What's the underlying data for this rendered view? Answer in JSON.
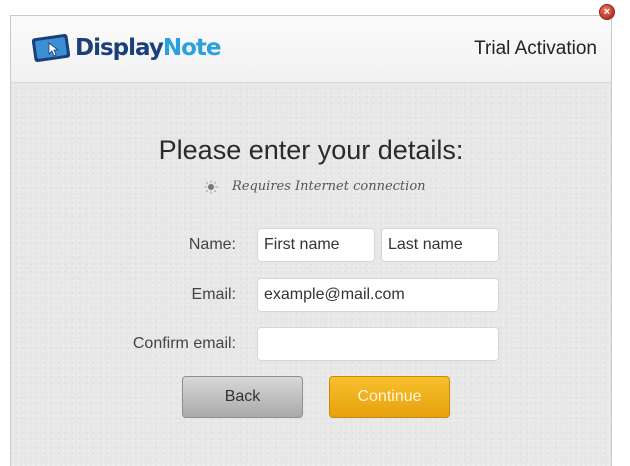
{
  "app": {
    "logo_part1": "Display",
    "logo_part2": "Note",
    "window_title": "Trial Activation",
    "close_glyph": "×"
  },
  "form": {
    "heading": "Please enter your details:",
    "note": "Requires Internet connection",
    "name_label": "Name:",
    "first_name_value": "First name",
    "last_name_value": "Last name",
    "email_label": "Email:",
    "email_value": "example@mail.com",
    "confirm_label": "Confirm email:",
    "confirm_value": ""
  },
  "buttons": {
    "back_label": "Back",
    "continue_label": "Continue"
  },
  "colors": {
    "brand_dark": "#1b3f7a",
    "brand_light": "#2aa0e0",
    "accent_orange": "#f0ae18"
  },
  "icons": [
    "displaynote-logo-icon",
    "close-icon",
    "bulb-icon"
  ]
}
